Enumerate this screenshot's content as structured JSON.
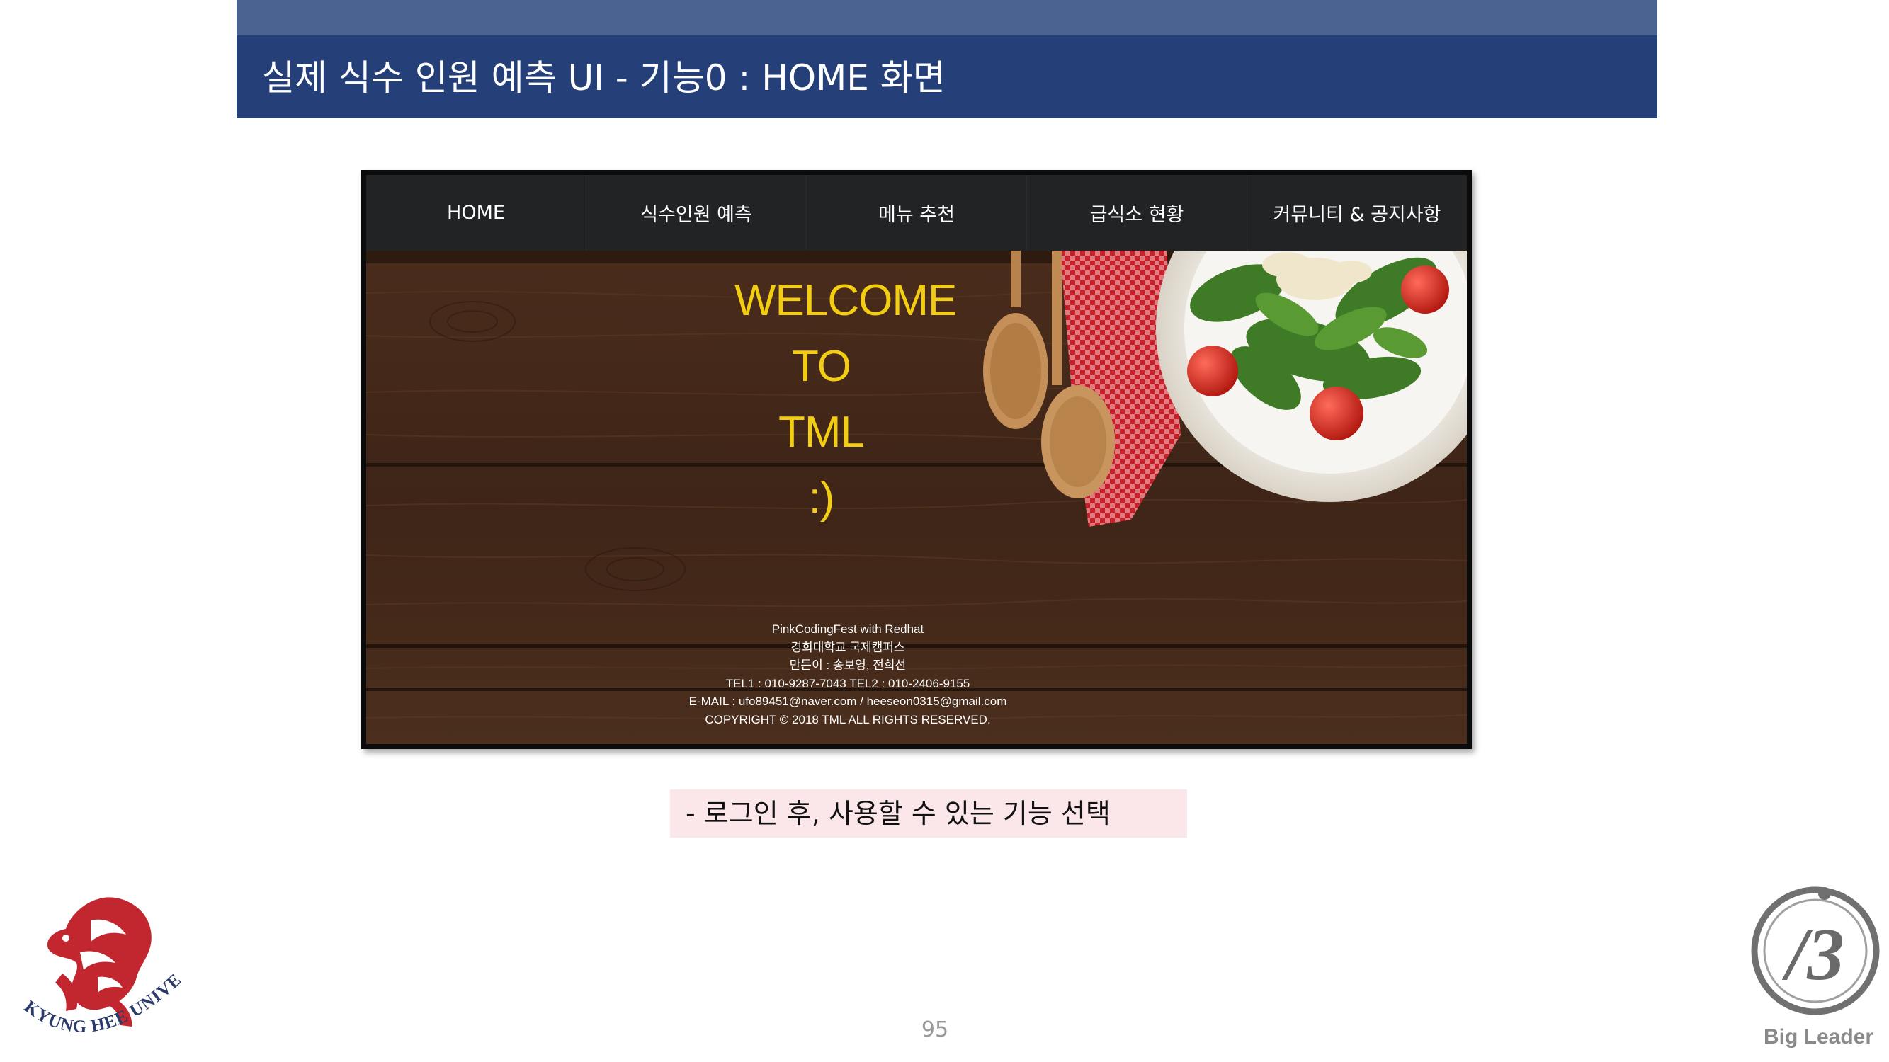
{
  "slide": {
    "title": "실제 식수 인원 예측 UI - 기능0 : HOME 화면",
    "caption": "- 로그인 후, 사용할 수 있는 기능 선택",
    "page_number": "95"
  },
  "website": {
    "nav": [
      {
        "label": "HOME"
      },
      {
        "label": "식수인원 예측"
      },
      {
        "label": "메뉴 추천"
      },
      {
        "label": "급식소 현황"
      },
      {
        "label": "커뮤니티 & 공지사항"
      }
    ],
    "hero": {
      "welcome_lines": [
        "WELCOME",
        "TO",
        "TML",
        ":)"
      ],
      "footer_lines": [
        "PinkCodingFest with Redhat",
        "경희대학교 국제캠퍼스",
        "만든이 : 송보영, 전희선",
        "TEL1 : 010-9287-7043    TEL2 : 010-2406-9155",
        "E-MAIL : ufo89451@naver.com / heeseon0315@gmail.com",
        "COPYRIGHT © 2018 TML ALL RIGHTS RESERVED."
      ]
    }
  },
  "logos": {
    "left": {
      "name": "kyung-hee-lion-logo",
      "text": "KYUNG HEE UNIVERSITY"
    },
    "right": {
      "name": "big-leader-logo",
      "text": "Big Leader"
    }
  },
  "colors": {
    "header_bar": "#253f78",
    "header_top": "#4a6290",
    "nav_bg": "#222325",
    "welcome_text": "#f2cd12",
    "caption_bg": "#fbe6ea",
    "logo_red": "#c2262f"
  }
}
